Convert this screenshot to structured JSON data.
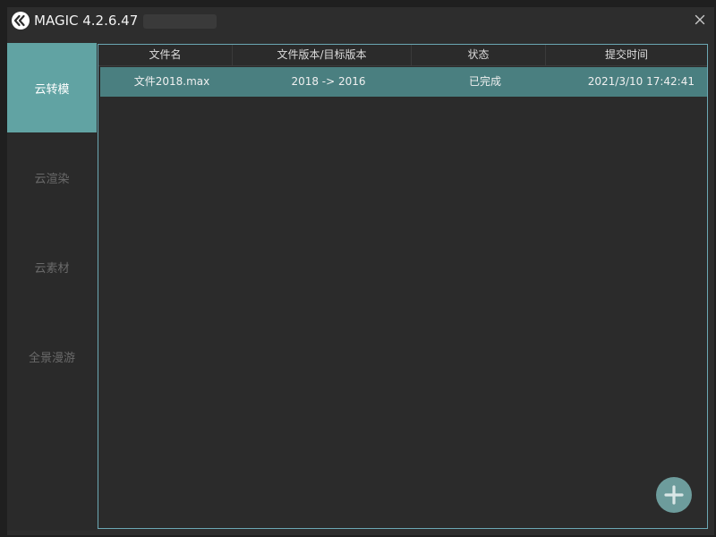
{
  "window": {
    "title": "MAGIC 4.2.6.47"
  },
  "sidebar": {
    "items": [
      {
        "label": "云转模",
        "active": true
      },
      {
        "label": "云渲染",
        "active": false
      },
      {
        "label": "云素材",
        "active": false
      },
      {
        "label": "全景漫游",
        "active": false
      }
    ]
  },
  "table": {
    "columns": [
      "文件名",
      "文件版本/目标版本",
      "状态",
      "提交时间"
    ],
    "rows": [
      {
        "filename": "文件2018.max",
        "version": "2018 -> 2016",
        "status": "已完成",
        "submitted": "2021/3/10 17:42:41"
      }
    ]
  },
  "icons": {
    "logo": "magic-logo-icon",
    "close": "close-icon",
    "add": "plus-icon"
  },
  "colors": {
    "accent": "#61a3a3",
    "row_selected": "#4a7f80",
    "content_border": "#6ba7b3",
    "add_button": "#6d9c9c",
    "background": "#2d2d2d"
  }
}
